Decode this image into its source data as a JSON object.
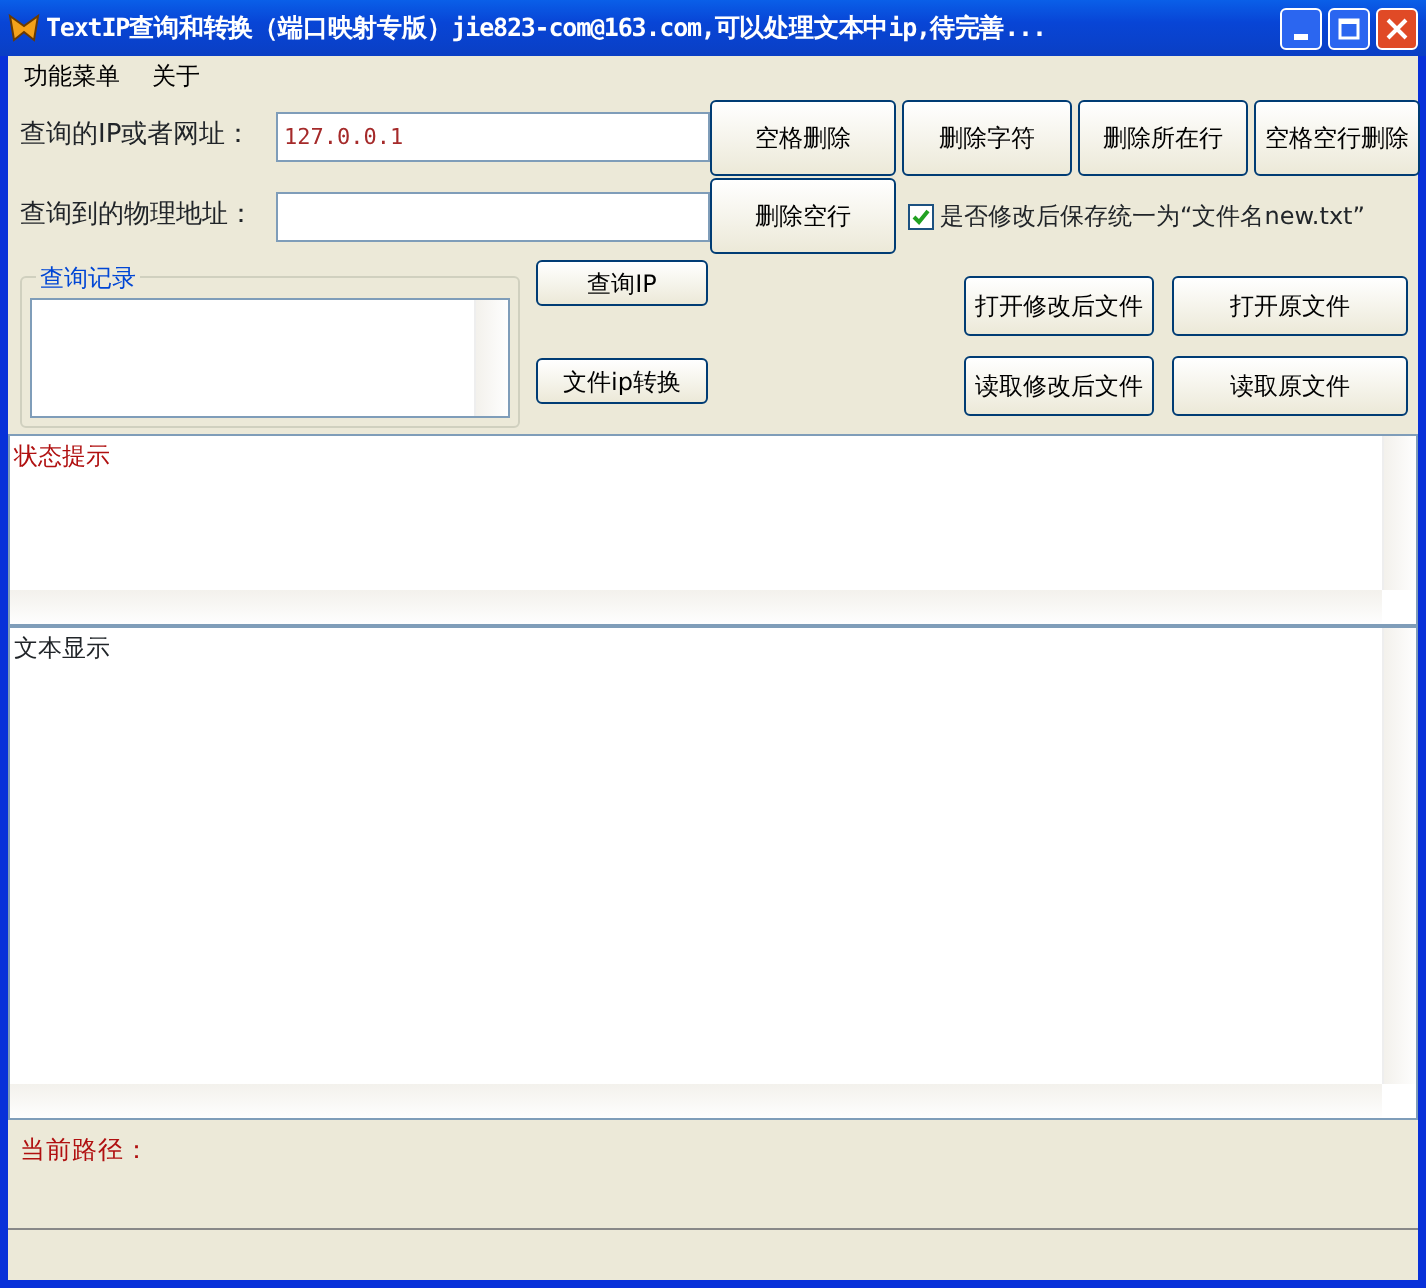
{
  "window": {
    "title": "TextIP查询和转换（端口映射专版）jie823-com@163.com,可以处理文本中ip,待完善..."
  },
  "menu": [
    "功能菜单",
    "关于"
  ],
  "fields": [
    {
      "label": "查询的IP或者网址：",
      "value": "127.0.0.1"
    },
    {
      "label": "查询到的物理地址："
    }
  ],
  "edit_buttons": [
    "空格删除",
    "删除字符",
    "删除所在行",
    "空格空行删除"
  ],
  "blank_line_button": "删除空行",
  "save_option": {
    "label": "是否修改后保存统一为“文件名new.txt”",
    "checked": true
  },
  "history": {
    "title": "查询记录"
  },
  "query_buttons": [
    "查询IP",
    "文件ip转换"
  ],
  "file_buttons": [
    "打开修改后文件",
    "打开原文件",
    "读取修改后文件",
    "读取原文件"
  ],
  "status_box": {
    "text": "状态提示"
  },
  "text_box": {
    "text": "文本显示"
  },
  "path": {
    "label": "当前路径："
  }
}
